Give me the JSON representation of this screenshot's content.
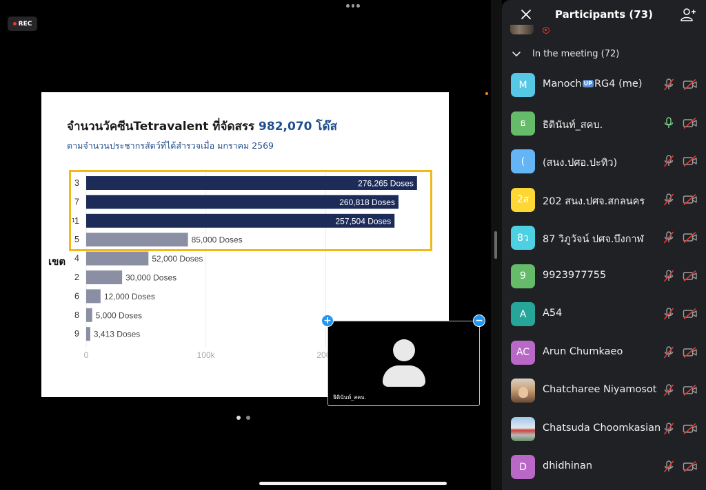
{
  "recording": {
    "label": "REC"
  },
  "slide": {
    "title_text": "จำนวนวัคซีนTetravalent ที่จัดสรร ",
    "title_number": "982,070 โด๊ส",
    "subtitle": "ตามจำนวนประชากรสัตว์ที่ได้สำรวจเมื่อ มกราคม 2569",
    "row_axis_label": "เขต",
    "highlight_fragment": "1"
  },
  "chart_data": {
    "type": "bar",
    "orientation": "horizontal",
    "categories": [
      "3",
      "7",
      "1",
      "5",
      "4",
      "2",
      "6",
      "8",
      "9"
    ],
    "values": [
      276265,
      260818,
      257504,
      85000,
      52000,
      30000,
      12000,
      5000,
      3413
    ],
    "data_labels": [
      "276,265 Doses",
      "260,818 Doses",
      "257,504 Doses",
      "85,000 Doses",
      "52,000 Doses",
      "30,000 Doses",
      "12,000 Doses",
      "5,000 Doses",
      "3,413 Doses"
    ],
    "x_ticks": [
      "0",
      "100k",
      "200k"
    ],
    "xlim": [
      0,
      285000
    ],
    "highlighted_categories": [
      "3",
      "7",
      "1",
      "5"
    ],
    "colors": {
      "top": "#1c2b58",
      "rest": "#8a8fa3",
      "highlight_border": "#f2b719"
    },
    "grid": true,
    "legend": "none"
  },
  "self_view": {
    "name": "ธิตินันท์_สคบ."
  },
  "panel": {
    "title": "Participants (73)",
    "section_label": "In the meeting (72)",
    "participants": [
      {
        "initials": "M",
        "name_before_badge": "Manoch",
        "badge": "UP",
        "name_after_badge": "RG4 (me)",
        "avatar_color": "#56c8e6",
        "mic": "muted",
        "camera": "off"
      },
      {
        "initials": "ธ",
        "name": "ธิตินันท์_สคบ.",
        "avatar_color": "#66bb6a",
        "mic": "on",
        "camera": "off"
      },
      {
        "initials": "(",
        "name": "(สนง.ปศอ.ปะทิว)",
        "avatar_color": "#64b5f6",
        "mic": "muted",
        "camera": "off"
      },
      {
        "initials": "2ส",
        "name": "202 สนง.ปศจ.สกลนคร",
        "avatar_color": "#fdd835",
        "mic": "muted",
        "camera": "off"
      },
      {
        "initials": "8ว",
        "name": "87 วิภูวัจน์ ปศจ.บึงกาฬ",
        "avatar_color": "#4dd0e1",
        "mic": "muted",
        "camera": "off"
      },
      {
        "initials": "9",
        "name": "9923977755",
        "avatar_color": "#66bb6a",
        "mic": "muted",
        "camera": "off"
      },
      {
        "initials": "A",
        "name": "A54",
        "avatar_color": "#26a69a",
        "mic": "muted",
        "camera": "off"
      },
      {
        "initials": "AC",
        "name": "Arun Chumkaeo",
        "avatar_color": "#ba68c8",
        "mic": "muted",
        "camera": "off"
      },
      {
        "initials": "",
        "name": "Chatcharee Niyamosot",
        "avatar_color": "#c9a27a",
        "avatar_photo": "portrait",
        "mic": "muted",
        "camera": "off"
      },
      {
        "initials": "",
        "name": "Chatsuda Choomkasian",
        "avatar_color": "#6fa3c8",
        "avatar_photo": "landscape",
        "mic": "muted",
        "camera": "off"
      },
      {
        "initials": "D",
        "name": "dhidhinan",
        "avatar_color": "#ba68c8",
        "mic": "muted",
        "camera": "off"
      }
    ]
  }
}
